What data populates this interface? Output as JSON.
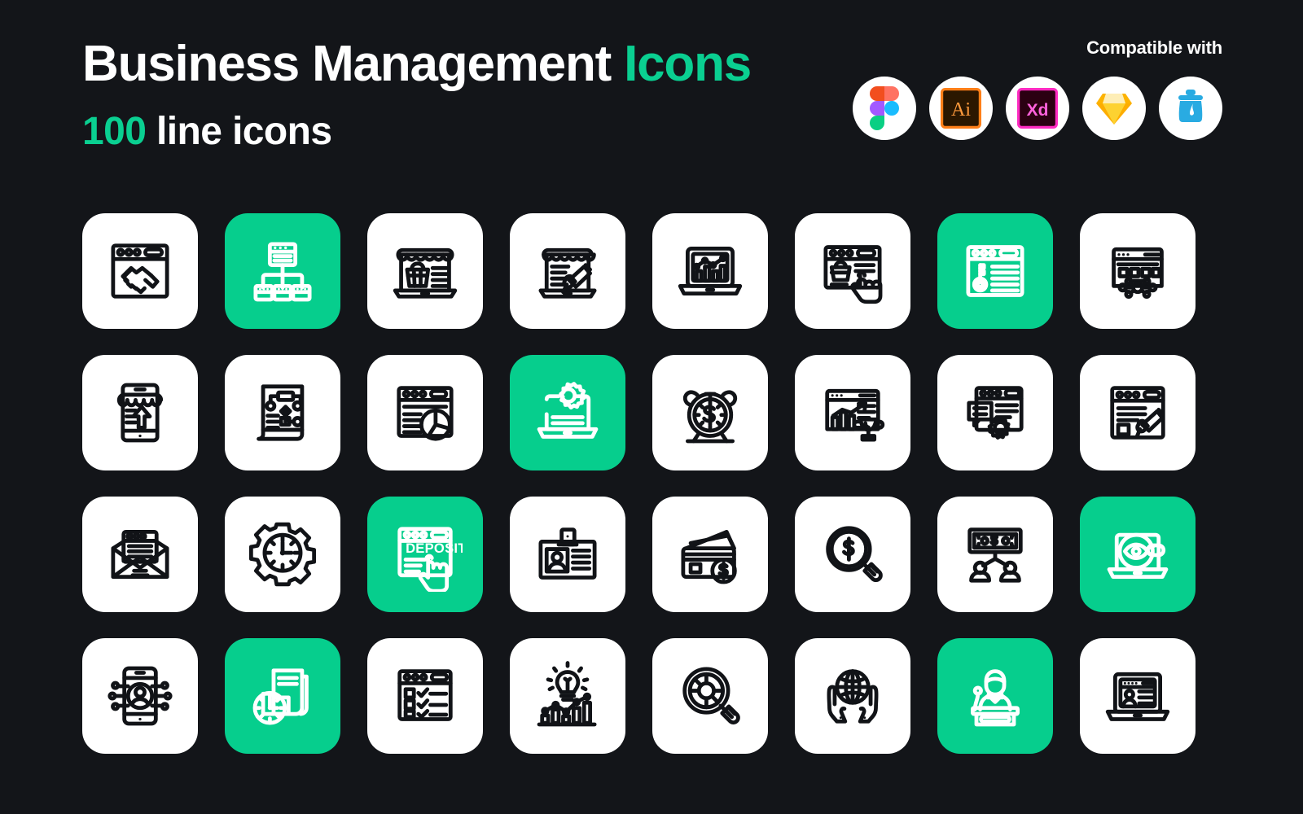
{
  "header": {
    "title_main": "Business Management",
    "title_accent": "Icons",
    "subtitle_count": "100",
    "subtitle_text": "line icons",
    "compatible_label": "Compatible with",
    "colors": {
      "background": "#131519",
      "accent_green": "#0ACF91",
      "tile_green": "#06CE8D",
      "tile_white": "#FFFFFF",
      "stroke_dark": "#111317"
    },
    "badges": [
      {
        "name": "figma-badge",
        "label": "Figma"
      },
      {
        "name": "illustrator-badge",
        "label": "Ai"
      },
      {
        "name": "adobe-xd-badge",
        "label": "Xd"
      },
      {
        "name": "sketch-badge",
        "label": "Sketch"
      },
      {
        "name": "inkscape-badge",
        "label": "Inkscape"
      }
    ]
  },
  "grid": {
    "columns": 8,
    "rows": 4,
    "total_visible": 32,
    "tiles": [
      {
        "icon": "browser-handshake-icon",
        "label": "Partnership",
        "style": "white"
      },
      {
        "icon": "sitemap-hierarchy-icon",
        "label": "Organization Structure",
        "style": "green"
      },
      {
        "icon": "laptop-shop-basket-icon",
        "label": "Online Store",
        "style": "white"
      },
      {
        "icon": "shop-megaphone-icon",
        "label": "Store Promotion",
        "style": "white"
      },
      {
        "icon": "laptop-analytics-icon",
        "label": "Data Analytics",
        "style": "white"
      },
      {
        "icon": "browser-cart-click-icon",
        "label": "Add To Cart",
        "style": "white"
      },
      {
        "icon": "browser-keyword-icon",
        "label": "Keyword Research",
        "style": "green"
      },
      {
        "icon": "browser-network-icon",
        "label": "Network Site",
        "style": "white"
      },
      {
        "icon": "mobile-shop-upload-icon",
        "label": "Mobile Commerce",
        "style": "white"
      },
      {
        "icon": "flowchart-document-icon",
        "label": "Workflow Plan",
        "style": "white"
      },
      {
        "icon": "browser-pie-chart-icon",
        "label": "Web Report",
        "style": "white"
      },
      {
        "icon": "laptop-gear-icon",
        "label": "System Settings",
        "style": "green"
      },
      {
        "icon": "alarm-clock-dollar-icon",
        "label": "Payment Due",
        "style": "white"
      },
      {
        "icon": "browser-growth-trophy-icon",
        "label": "Business Success",
        "style": "white"
      },
      {
        "icon": "browser-chat-gear-icon",
        "label": "Support Settings",
        "style": "white"
      },
      {
        "icon": "browser-megaphone-icon",
        "label": "Web Advertising",
        "style": "white"
      },
      {
        "icon": "email-newsletter-icon",
        "label": "Email Campaign",
        "style": "white"
      },
      {
        "icon": "gear-clock-icon",
        "label": "Time Management",
        "style": "white"
      },
      {
        "icon": "browser-deposit-icon",
        "label": "Deposit",
        "style": "green",
        "text": "DEPOSIT"
      },
      {
        "icon": "id-badge-icon",
        "label": "Employee ID",
        "style": "white"
      },
      {
        "icon": "credit-card-dollar-icon",
        "label": "Card Payment",
        "style": "white"
      },
      {
        "icon": "magnifier-dollar-icon",
        "label": "Find Funding",
        "style": "white"
      },
      {
        "icon": "money-distribution-users-icon",
        "label": "Revenue Sharing",
        "style": "white"
      },
      {
        "icon": "laptop-eye-search-icon",
        "label": "Monitoring",
        "style": "green"
      },
      {
        "icon": "mobile-user-network-icon",
        "label": "Digital Identity",
        "style": "white"
      },
      {
        "icon": "document-clock-icon",
        "label": "Document Schedule",
        "style": "green"
      },
      {
        "icon": "browser-checklist-icon",
        "label": "Task Checklist",
        "style": "white"
      },
      {
        "icon": "idea-growth-chart-icon",
        "label": "Creative Growth",
        "style": "white"
      },
      {
        "icon": "donut-chart-magnifier-icon",
        "label": "Market Research",
        "style": "white"
      },
      {
        "icon": "hands-globe-icon",
        "label": "Global Care",
        "style": "white"
      },
      {
        "icon": "speaker-podium-icon",
        "label": "Public Speaking",
        "style": "green"
      },
      {
        "icon": "laptop-profile-icon",
        "label": "User Profile",
        "style": "white"
      }
    ]
  }
}
